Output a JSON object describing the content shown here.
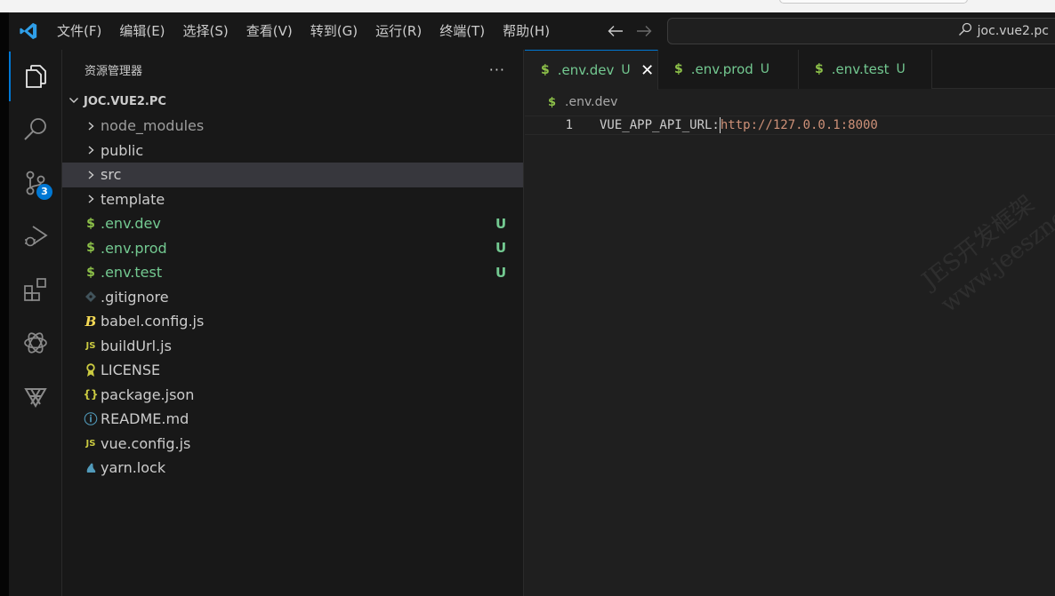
{
  "titlebar": {
    "menu": [
      "文件(F)",
      "编辑(E)",
      "选择(S)",
      "查看(V)",
      "转到(G)",
      "运行(R)",
      "终端(T)",
      "帮助(H)"
    ],
    "search_text": "joc.vue2.pc"
  },
  "activity_bar": {
    "items": [
      "explorer-icon",
      "search-icon",
      "source-control-icon",
      "run-debug-icon",
      "extensions-icon",
      "openai-icon",
      "remote-icon"
    ],
    "source_control_badge": "3"
  },
  "explorer": {
    "title": "资源管理器",
    "more": "···",
    "folder": "JOC.VUE2.PC",
    "items": [
      {
        "label": "node_modules",
        "kind": "folder",
        "icon": "chevron-right-icon",
        "status": ""
      },
      {
        "label": "public",
        "kind": "folder",
        "icon": "chevron-right-icon",
        "status": ""
      },
      {
        "label": "src",
        "kind": "folder",
        "icon": "chevron-right-icon",
        "status": ""
      },
      {
        "label": "template",
        "kind": "folder",
        "icon": "chevron-right-icon",
        "status": ""
      },
      {
        "label": ".env.dev",
        "kind": "file",
        "icon": "dollar-icon",
        "status": "U"
      },
      {
        "label": ".env.prod",
        "kind": "file",
        "icon": "dollar-icon",
        "status": "U"
      },
      {
        "label": ".env.test",
        "kind": "file",
        "icon": "dollar-icon",
        "status": "U"
      },
      {
        "label": ".gitignore",
        "kind": "file",
        "icon": "git-icon",
        "status": ""
      },
      {
        "label": "babel.config.js",
        "kind": "file",
        "icon": "babel-icon",
        "status": ""
      },
      {
        "label": "buildUrl.js",
        "kind": "file",
        "icon": "js-icon",
        "status": ""
      },
      {
        "label": "LICENSE",
        "kind": "file",
        "icon": "license-icon",
        "status": ""
      },
      {
        "label": "package.json",
        "kind": "file",
        "icon": "json-icon",
        "status": ""
      },
      {
        "label": "README.md",
        "kind": "file",
        "icon": "info-icon",
        "status": ""
      },
      {
        "label": "vue.config.js",
        "kind": "file",
        "icon": "js-icon",
        "status": ""
      },
      {
        "label": "yarn.lock",
        "kind": "file",
        "icon": "yarn-icon",
        "status": ""
      }
    ]
  },
  "editor": {
    "tabs": [
      {
        "name": ".env.dev",
        "status": "U",
        "close": "✕"
      },
      {
        "name": ".env.prod",
        "status": "U"
      },
      {
        "name": ".env.test",
        "status": "U"
      }
    ],
    "breadcrumb": ".env.dev",
    "line_number": "1",
    "code_key": "VUE_APP_API_URL:",
    "code_value": "http://127.0.0.1:8000"
  },
  "icon_glyphs": {
    "dollar": "$",
    "js": "JS",
    "json": "{}",
    "babel": "B",
    "info": "ⓘ"
  },
  "watermark": {
    "line1": "JES开发框架",
    "line2": "www.jeesznet.com"
  },
  "colors": {
    "accent": "#0078d4",
    "untracked_green": "#73c991",
    "sidebar_bg": "#181818",
    "editor_bg": "#1f1f1f",
    "selection": "#37373d"
  }
}
